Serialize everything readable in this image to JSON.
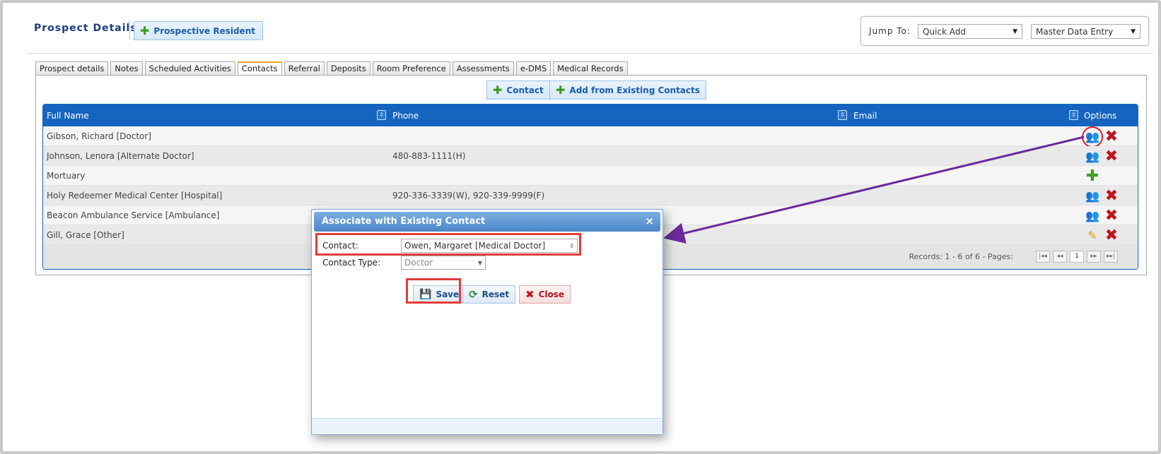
{
  "header": {
    "title": "Prospect Details",
    "prospective_resident_label": "Prospective Resident",
    "jump_to_label": "Jump To:",
    "jump_select_1": "Quick Add",
    "jump_select_2": "Master Data Entry"
  },
  "tabs": [
    {
      "label": "Prospect details"
    },
    {
      "label": "Notes"
    },
    {
      "label": "Scheduled Activities"
    },
    {
      "label": "Contacts",
      "active": true
    },
    {
      "label": "Referral"
    },
    {
      "label": "Deposits"
    },
    {
      "label": "Room Preference"
    },
    {
      "label": "Assessments"
    },
    {
      "label": "e-DMS"
    },
    {
      "label": "Medical Records"
    }
  ],
  "actions": {
    "contact_label": "Contact",
    "add_existing_label": "Add from Existing Contacts"
  },
  "grid": {
    "columns": [
      "Full Name",
      "Phone",
      "Email",
      "Options"
    ],
    "rows": [
      {
        "name": "Gibson, Richard [Doctor]",
        "phone": "",
        "email": "",
        "options": [
          "associate",
          "delete"
        ]
      },
      {
        "name": "Johnson, Lenora [Alternate Doctor]",
        "phone": "480-883-1111(H)",
        "email": "",
        "options": [
          "associate",
          "delete"
        ]
      },
      {
        "name": "Mortuary",
        "phone": "",
        "email": "",
        "options": [
          "add"
        ]
      },
      {
        "name": "Holy Redeemer Medical Center [Hospital]",
        "phone": "920-336-3339(W), 920-339-9999(F)",
        "email": "",
        "options": [
          "associate",
          "delete"
        ]
      },
      {
        "name": "Beacon Ambulance Service [Ambulance]",
        "phone": "",
        "email": "",
        "options": [
          "associate",
          "delete"
        ]
      },
      {
        "name": "Gill, Grace [Other]",
        "phone": "",
        "email": "",
        "options": [
          "edit",
          "delete"
        ]
      }
    ],
    "records_text": "Records: 1 - 6 of 6 - Pages:",
    "page": "1"
  },
  "dialog": {
    "title": "Associate with Existing Contact",
    "close_glyph": "×",
    "contact_label": "Contact:",
    "contact_value": "Owen, Margaret [Medical Doctor]",
    "contact_type_label": "Contact Type:",
    "contact_type_value": "Doctor",
    "save_label": "Save",
    "reset_label": "Reset",
    "close_label": "Close"
  },
  "colors": {
    "grid_header": "#1565c0",
    "highlight": "#e53b3b",
    "arrow": "#6a2a9a",
    "button_text": "#1a5ea8"
  }
}
